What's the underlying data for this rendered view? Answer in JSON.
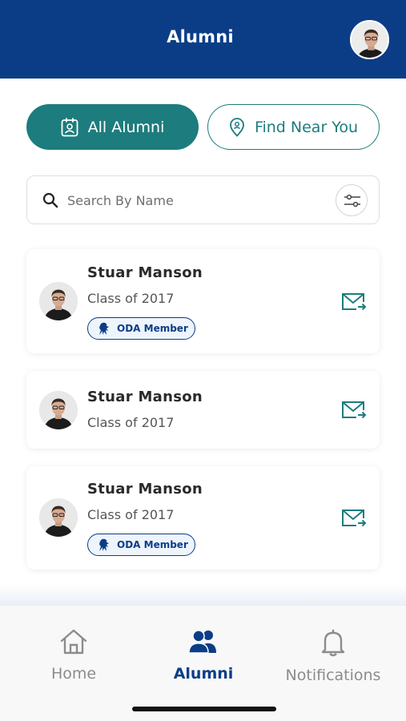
{
  "header": {
    "title": "Alumni"
  },
  "segments": {
    "all_label": "All Alumni",
    "near_label": "Find Near You"
  },
  "search": {
    "placeholder": "Search By Name"
  },
  "alumni": [
    {
      "name": "Stuar Manson",
      "class": "Class of 2017",
      "badge": "ODA Member"
    },
    {
      "name": "Stuar Manson",
      "class": "Class of 2017"
    },
    {
      "name": "Stuar Manson",
      "class": "Class of 2017",
      "badge": "ODA Member"
    }
  ],
  "nav": {
    "home": "Home",
    "alumni": "Alumni",
    "notifications": "Notifications",
    "active": "alumni"
  },
  "icons": {
    "avatar": "person-avatar-icon",
    "all_alumni": "contact-badge-icon",
    "find_near": "location-pin-icon",
    "search": "search-icon",
    "filter": "filter-sliders-icon",
    "badge": "lion-crest-icon",
    "message": "mail-send-icon",
    "home": "home-icon",
    "alumni": "people-icon",
    "notifications": "bell-icon"
  },
  "colors": {
    "brand_blue": "#0b3d87",
    "accent_teal": "#1d7c7d",
    "nav_inactive": "#8c8c8c"
  }
}
